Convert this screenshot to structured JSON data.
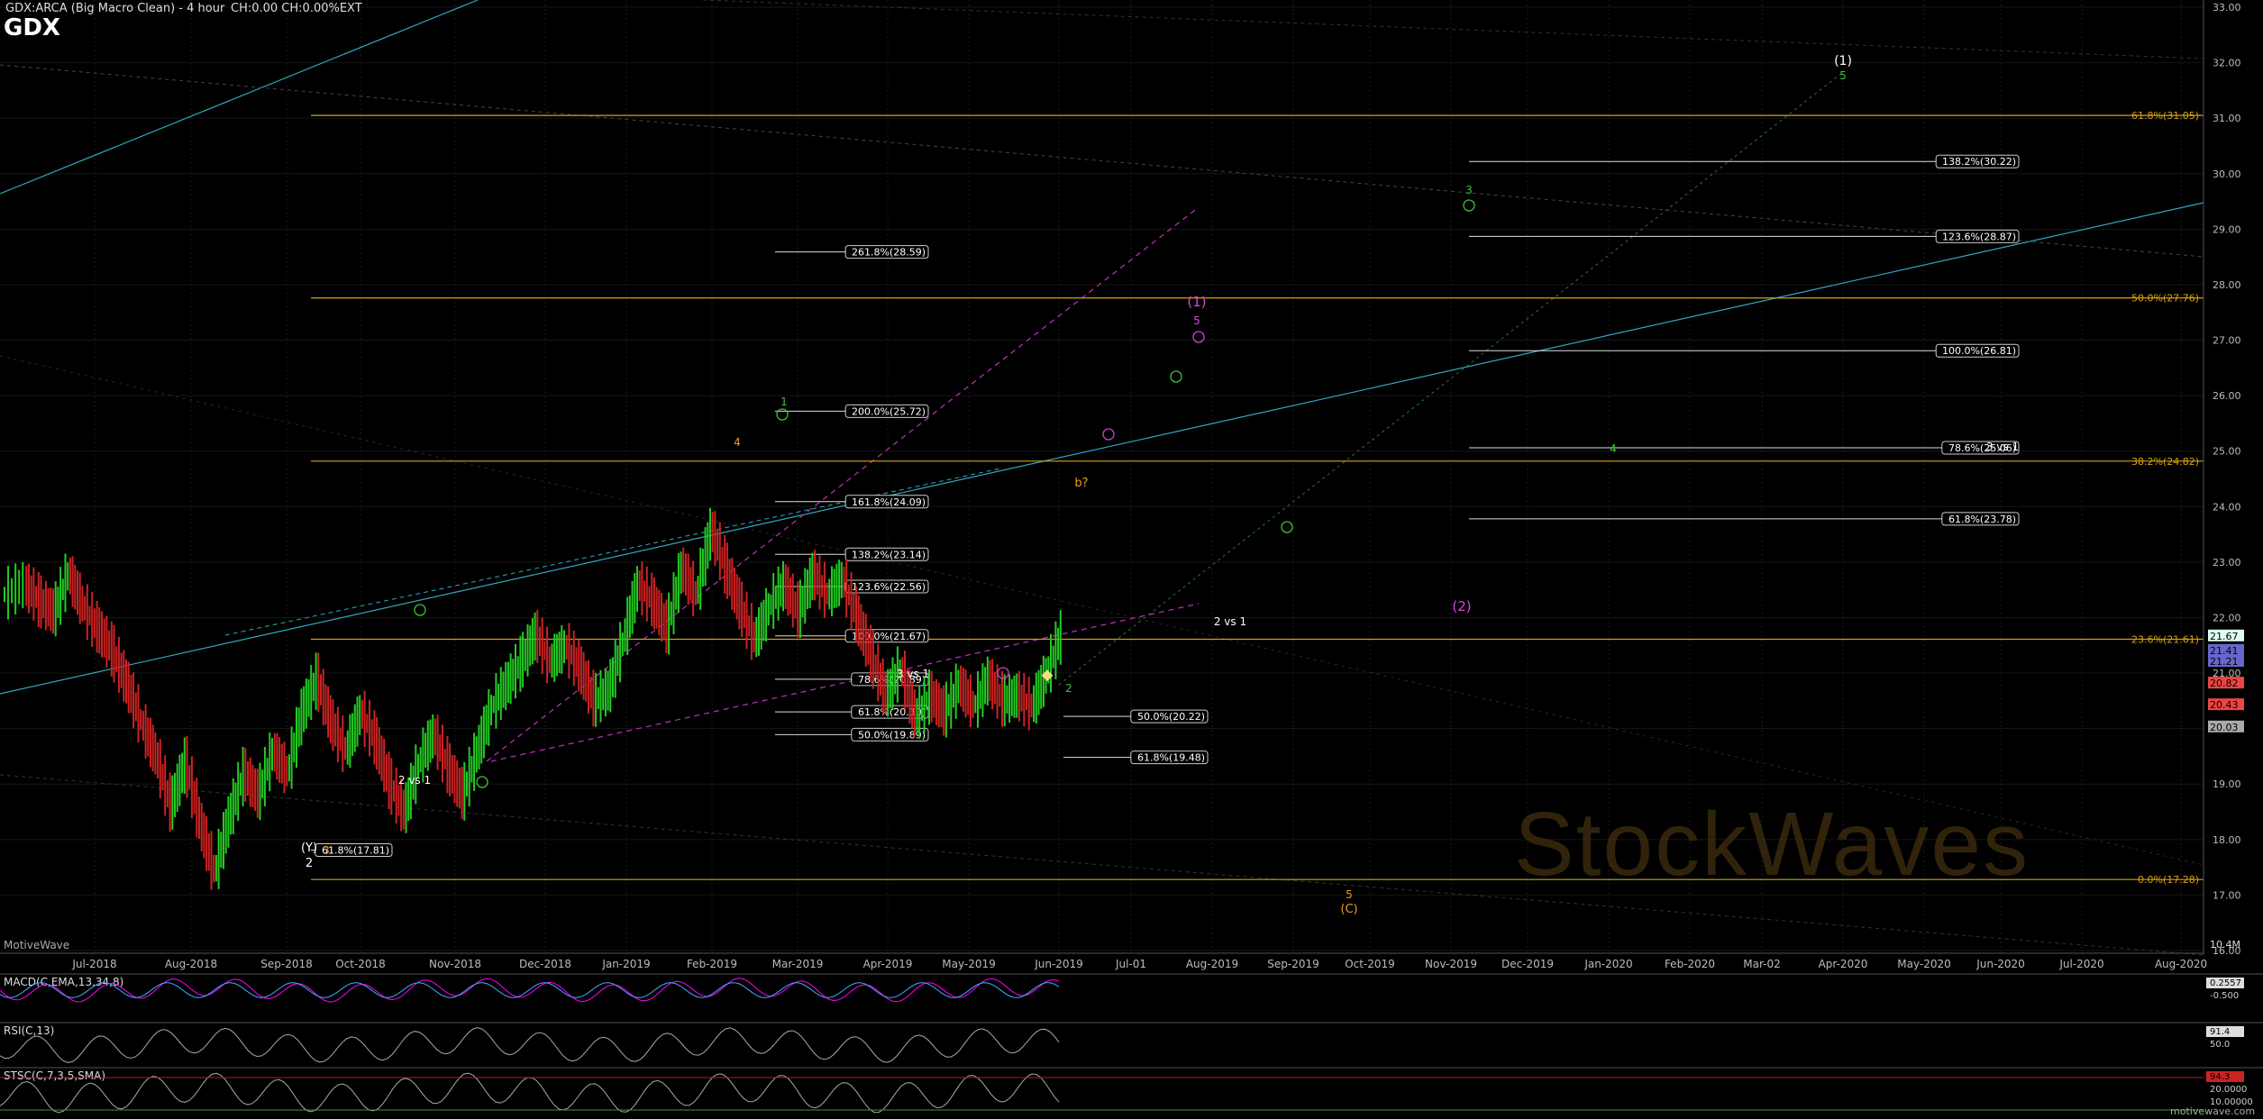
{
  "header": {
    "symbol_line": "GDX:ARCA (Big Macro Clean) - 4 hour",
    "change_line": "CH:0.00 CH:0.00%EXT",
    "ticker": "GDX",
    "source": "MotiveWave",
    "watermark": "StockWaves",
    "footer_brand": "motivewave.com"
  },
  "colors": {
    "background": "#000000",
    "fib_gold": "#d4a017",
    "fib_white": "#ffffff",
    "trend_cyan": "#2fa8c0",
    "trend_magenta": "#c030c0",
    "wave_green": "#3cc03c",
    "wave_orange": "#e8a020",
    "up_bar": "#22cc22",
    "down_bar": "#cc2222"
  },
  "chart_data": {
    "type": "line",
    "title": "GDX",
    "price_axis": {
      "ylim": [
        16.0,
        33.0
      ],
      "ticks": [
        "33.00",
        "32.00",
        "31.00",
        "30.00",
        "29.00",
        "28.00",
        "27.00",
        "26.00",
        "25.00",
        "24.00",
        "23.00",
        "22.00",
        "21.00",
        "20.00",
        "19.00",
        "18.00",
        "17.00",
        "16.00"
      ],
      "current_markers": [
        "21.67",
        "21.41",
        "21.21",
        "20.82",
        "20.43",
        "20.03"
      ]
    },
    "time_axis": {
      "labels": [
        "Jul-2018",
        "Aug-2018",
        "Sep-2018",
        "Oct-2018",
        "Nov-2018",
        "Dec-2018",
        "Jan-2019",
        "Feb-2019",
        "Mar-2019",
        "Apr-2019",
        "May-2019",
        "Jun-2019",
        "Jul-01",
        "Aug-2019",
        "Sep-2019",
        "Oct-2019",
        "Nov-2019",
        "Dec-2019",
        "Jan-2020",
        "Feb-2020",
        "Mar-02",
        "Apr-2020",
        "May-2020",
        "Jun-2020",
        "Jul-2020",
        "Aug-2020"
      ]
    },
    "price_series": [
      [
        0,
        22.4
      ],
      [
        6,
        22.6
      ],
      [
        10,
        22.3
      ],
      [
        14,
        22.1
      ],
      [
        18,
        22.8
      ],
      [
        22,
        22.2
      ],
      [
        26,
        21.8
      ],
      [
        30,
        21.4
      ],
      [
        34,
        20.8
      ],
      [
        38,
        20.1
      ],
      [
        42,
        19.5
      ],
      [
        46,
        18.6
      ],
      [
        50,
        19.4
      ],
      [
        54,
        18.3
      ],
      [
        58,
        17.4
      ],
      [
        62,
        18.4
      ],
      [
        66,
        19.2
      ],
      [
        70,
        18.8
      ],
      [
        74,
        19.6
      ],
      [
        78,
        19.2
      ],
      [
        82,
        20.3
      ],
      [
        86,
        20.9
      ],
      [
        90,
        20.1
      ],
      [
        94,
        19.6
      ],
      [
        98,
        20.3
      ],
      [
        102,
        19.8
      ],
      [
        106,
        19.0
      ],
      [
        110,
        18.5
      ],
      [
        114,
        19.4
      ],
      [
        118,
        19.9
      ],
      [
        122,
        19.3
      ],
      [
        126,
        18.8
      ],
      [
        130,
        19.6
      ],
      [
        134,
        20.4
      ],
      [
        138,
        20.8
      ],
      [
        142,
        21.2
      ],
      [
        146,
        21.7
      ],
      [
        150,
        21.2
      ],
      [
        154,
        21.5
      ],
      [
        158,
        21.1
      ],
      [
        162,
        20.5
      ],
      [
        166,
        20.7
      ],
      [
        170,
        21.6
      ],
      [
        174,
        22.6
      ],
      [
        178,
        22.3
      ],
      [
        182,
        21.8
      ],
      [
        186,
        22.9
      ],
      [
        190,
        22.4
      ],
      [
        194,
        23.6
      ],
      [
        198,
        22.9
      ],
      [
        202,
        22.2
      ],
      [
        206,
        21.6
      ],
      [
        210,
        22.2
      ],
      [
        214,
        22.6
      ],
      [
        218,
        22.1
      ],
      [
        222,
        22.8
      ],
      [
        226,
        22.4
      ],
      [
        230,
        22.7
      ],
      [
        234,
        22.0
      ],
      [
        238,
        21.3
      ],
      [
        242,
        20.6
      ],
      [
        246,
        21.1
      ],
      [
        250,
        20.2
      ],
      [
        254,
        20.6
      ],
      [
        258,
        20.3
      ],
      [
        262,
        20.8
      ],
      [
        266,
        20.4
      ],
      [
        270,
        20.9
      ],
      [
        274,
        20.5
      ],
      [
        278,
        20.6
      ],
      [
        282,
        20.4
      ],
      [
        286,
        21.0
      ],
      [
        290,
        21.7
      ]
    ],
    "price_range": [
      16.0,
      33.0
    ],
    "fib_levels_gold": [
      {
        "label": "61.8%(31.05)",
        "value": 31.05
      },
      {
        "label": "50.0%(27.76)",
        "value": 27.76
      },
      {
        "label": "38.2%(24.82)",
        "value": 24.82
      },
      {
        "label": "23.6%(21.61)",
        "value": 21.61
      },
      {
        "label": "0.0%(17.28)",
        "value": 17.28
      }
    ],
    "fib_levels_white": [
      {
        "label": "138.2%(30.22)",
        "value": 30.22
      },
      {
        "label": "123.6%(28.87)",
        "value": 28.87
      },
      {
        "label": "100.0%(26.81)",
        "value": 26.81
      },
      {
        "label": "78.6%(25.06)",
        "value": 25.06
      },
      {
        "label": "61.8%(23.78)",
        "value": 23.78
      },
      {
        "label": "261.8%(28.59)",
        "value": 28.59
      },
      {
        "label": "200.0%(25.72)",
        "value": 25.72
      },
      {
        "label": "161.8%(24.09)",
        "value": 24.09
      },
      {
        "label": "138.2%(23.14)",
        "value": 23.14
      },
      {
        "label": "123.6%(22.56)",
        "value": 22.56
      },
      {
        "label": "100.0%(21.67)",
        "value": 21.67
      },
      {
        "label": "78.6%(20.89)",
        "value": 20.89
      },
      {
        "label": "61.8%(20.30)",
        "value": 20.3
      },
      {
        "label": "50.0%(19.89)",
        "value": 19.89
      },
      {
        "label": "50.0%(20.22)",
        "value": 20.22
      },
      {
        "label": "61.8%(19.48)",
        "value": 19.48
      },
      {
        "label": "61.8%(17.81)",
        "value": 17.81
      }
    ],
    "annotations": [
      "(1)",
      "5",
      "3",
      "(1)",
      "5",
      "1",
      "4",
      "b?",
      "(2)",
      "2 vs 1",
      "3 vs 1",
      "3 vs 1",
      "2 vs 1",
      "(Y)",
      "2",
      "3",
      "(C)",
      "5",
      "4",
      "2"
    ],
    "indicators": [
      {
        "name": "MACD(C,EMA,13,34,8)",
        "values": [
          "0.2557",
          "-0.500"
        ]
      },
      {
        "name": "RSI(C,13)",
        "values": [
          "91.4",
          "50.0"
        ]
      },
      {
        "name": "STSC(C,7,3,5,SMA)",
        "values": [
          "94.3",
          "20.0000",
          "10.00000"
        ]
      }
    ],
    "volume_label": "10.4M"
  }
}
